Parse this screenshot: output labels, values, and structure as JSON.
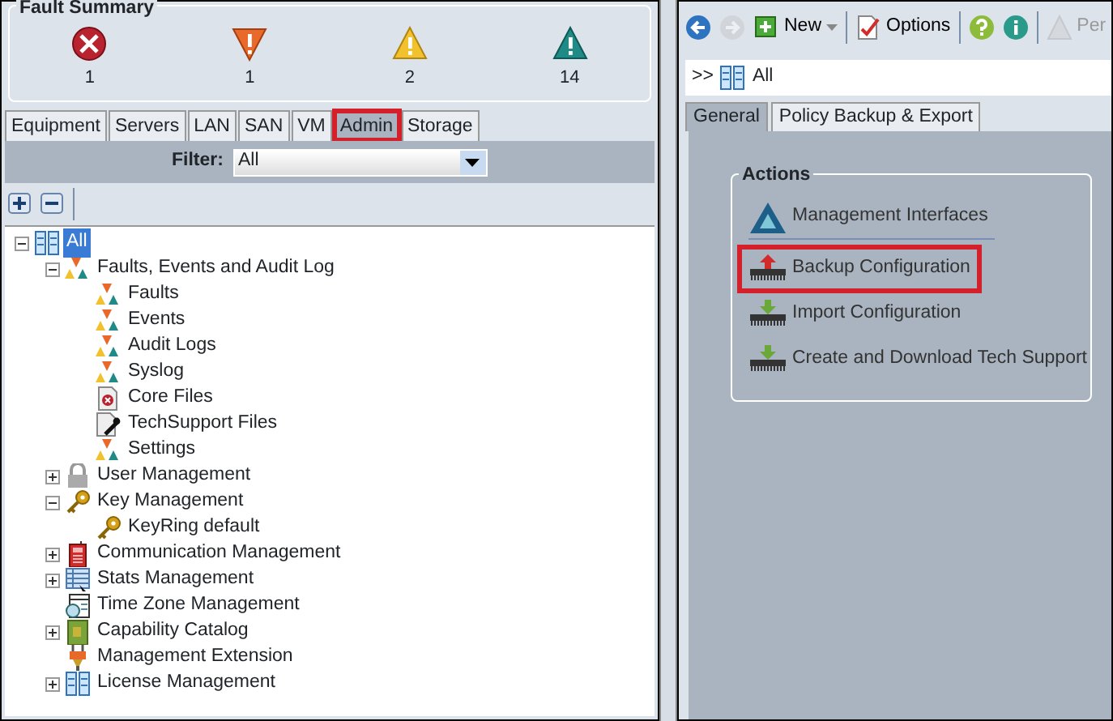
{
  "fault_summary": {
    "title": "Fault Summary",
    "faults": [
      {
        "kind": "critical",
        "count": "1"
      },
      {
        "kind": "major",
        "count": "1"
      },
      {
        "kind": "minor",
        "count": "2"
      },
      {
        "kind": "warning",
        "count": "14"
      }
    ]
  },
  "nav_tabs": [
    {
      "label": "Equipment",
      "selected": false,
      "highlighted": false
    },
    {
      "label": "Servers",
      "selected": false,
      "highlighted": false
    },
    {
      "label": "LAN",
      "selected": false,
      "highlighted": false
    },
    {
      "label": "SAN",
      "selected": false,
      "highlighted": false
    },
    {
      "label": "VM",
      "selected": false,
      "highlighted": false
    },
    {
      "label": "Admin",
      "selected": true,
      "highlighted": true
    },
    {
      "label": "Storage",
      "selected": false,
      "highlighted": false
    }
  ],
  "filter": {
    "label": "Filter:",
    "value": "All"
  },
  "tree": [
    {
      "label": "All",
      "kind": "root",
      "expanded": true,
      "selected": true,
      "children": [
        {
          "label": "Faults, Events and Audit Log",
          "kind": "log",
          "expanded": true,
          "selected": false,
          "children": [
            {
              "label": "Faults",
              "kind": "log",
              "selected": false
            },
            {
              "label": "Events",
              "kind": "log",
              "selected": false
            },
            {
              "label": "Audit Logs",
              "kind": "log",
              "selected": false
            },
            {
              "label": "Syslog",
              "kind": "log",
              "selected": false
            },
            {
              "label": "Core Files",
              "kind": "corefile",
              "selected": false
            },
            {
              "label": "TechSupport Files",
              "kind": "wrenchfile",
              "selected": false
            },
            {
              "label": "Settings",
              "kind": "log",
              "selected": false
            }
          ]
        },
        {
          "label": "User Management",
          "kind": "lock",
          "expanded": false,
          "selected": false
        },
        {
          "label": "Key Management",
          "kind": "key",
          "expanded": true,
          "selected": false,
          "children": [
            {
              "label": "KeyRing default",
              "kind": "key",
              "selected": false
            }
          ]
        },
        {
          "label": "Communication Management",
          "kind": "phone",
          "expanded": false,
          "selected": false
        },
        {
          "label": "Stats Management",
          "kind": "stats",
          "expanded": false,
          "selected": false
        },
        {
          "label": "Time Zone Management",
          "kind": "clock",
          "selected": false
        },
        {
          "label": "Capability Catalog",
          "kind": "catalog",
          "expanded": false,
          "selected": false
        },
        {
          "label": "Management Extension",
          "kind": "plug",
          "selected": false
        },
        {
          "label": "License Management",
          "kind": "root",
          "expanded": false,
          "selected": false
        }
      ]
    }
  ],
  "toolbar": [
    {
      "kind": "back",
      "disabled": false
    },
    {
      "kind": "forward",
      "disabled": true
    },
    {
      "kind": "new",
      "label": "New",
      "disabled": false
    },
    {
      "kind": "options",
      "label": "Options",
      "disabled": false
    },
    {
      "kind": "help",
      "disabled": false
    },
    {
      "kind": "info",
      "disabled": false
    },
    {
      "kind": "pending",
      "label": "Per",
      "disabled": true
    }
  ],
  "breadcrumb": {
    "prefix": ">>",
    "label": "All"
  },
  "content_tabs": [
    {
      "label": "General",
      "selected": true
    },
    {
      "label": "Policy Backup & Export",
      "selected": false
    }
  ],
  "actions": {
    "title": "Actions",
    "items": [
      {
        "label": "Management Interfaces",
        "kind": "interfaces",
        "highlighted": false
      },
      {
        "label": "Backup Configuration",
        "kind": "backup",
        "highlighted": true
      },
      {
        "label": "Import Configuration",
        "kind": "import",
        "highlighted": false
      },
      {
        "label": "Create and Download Tech Support",
        "kind": "import",
        "highlighted": false
      }
    ]
  }
}
